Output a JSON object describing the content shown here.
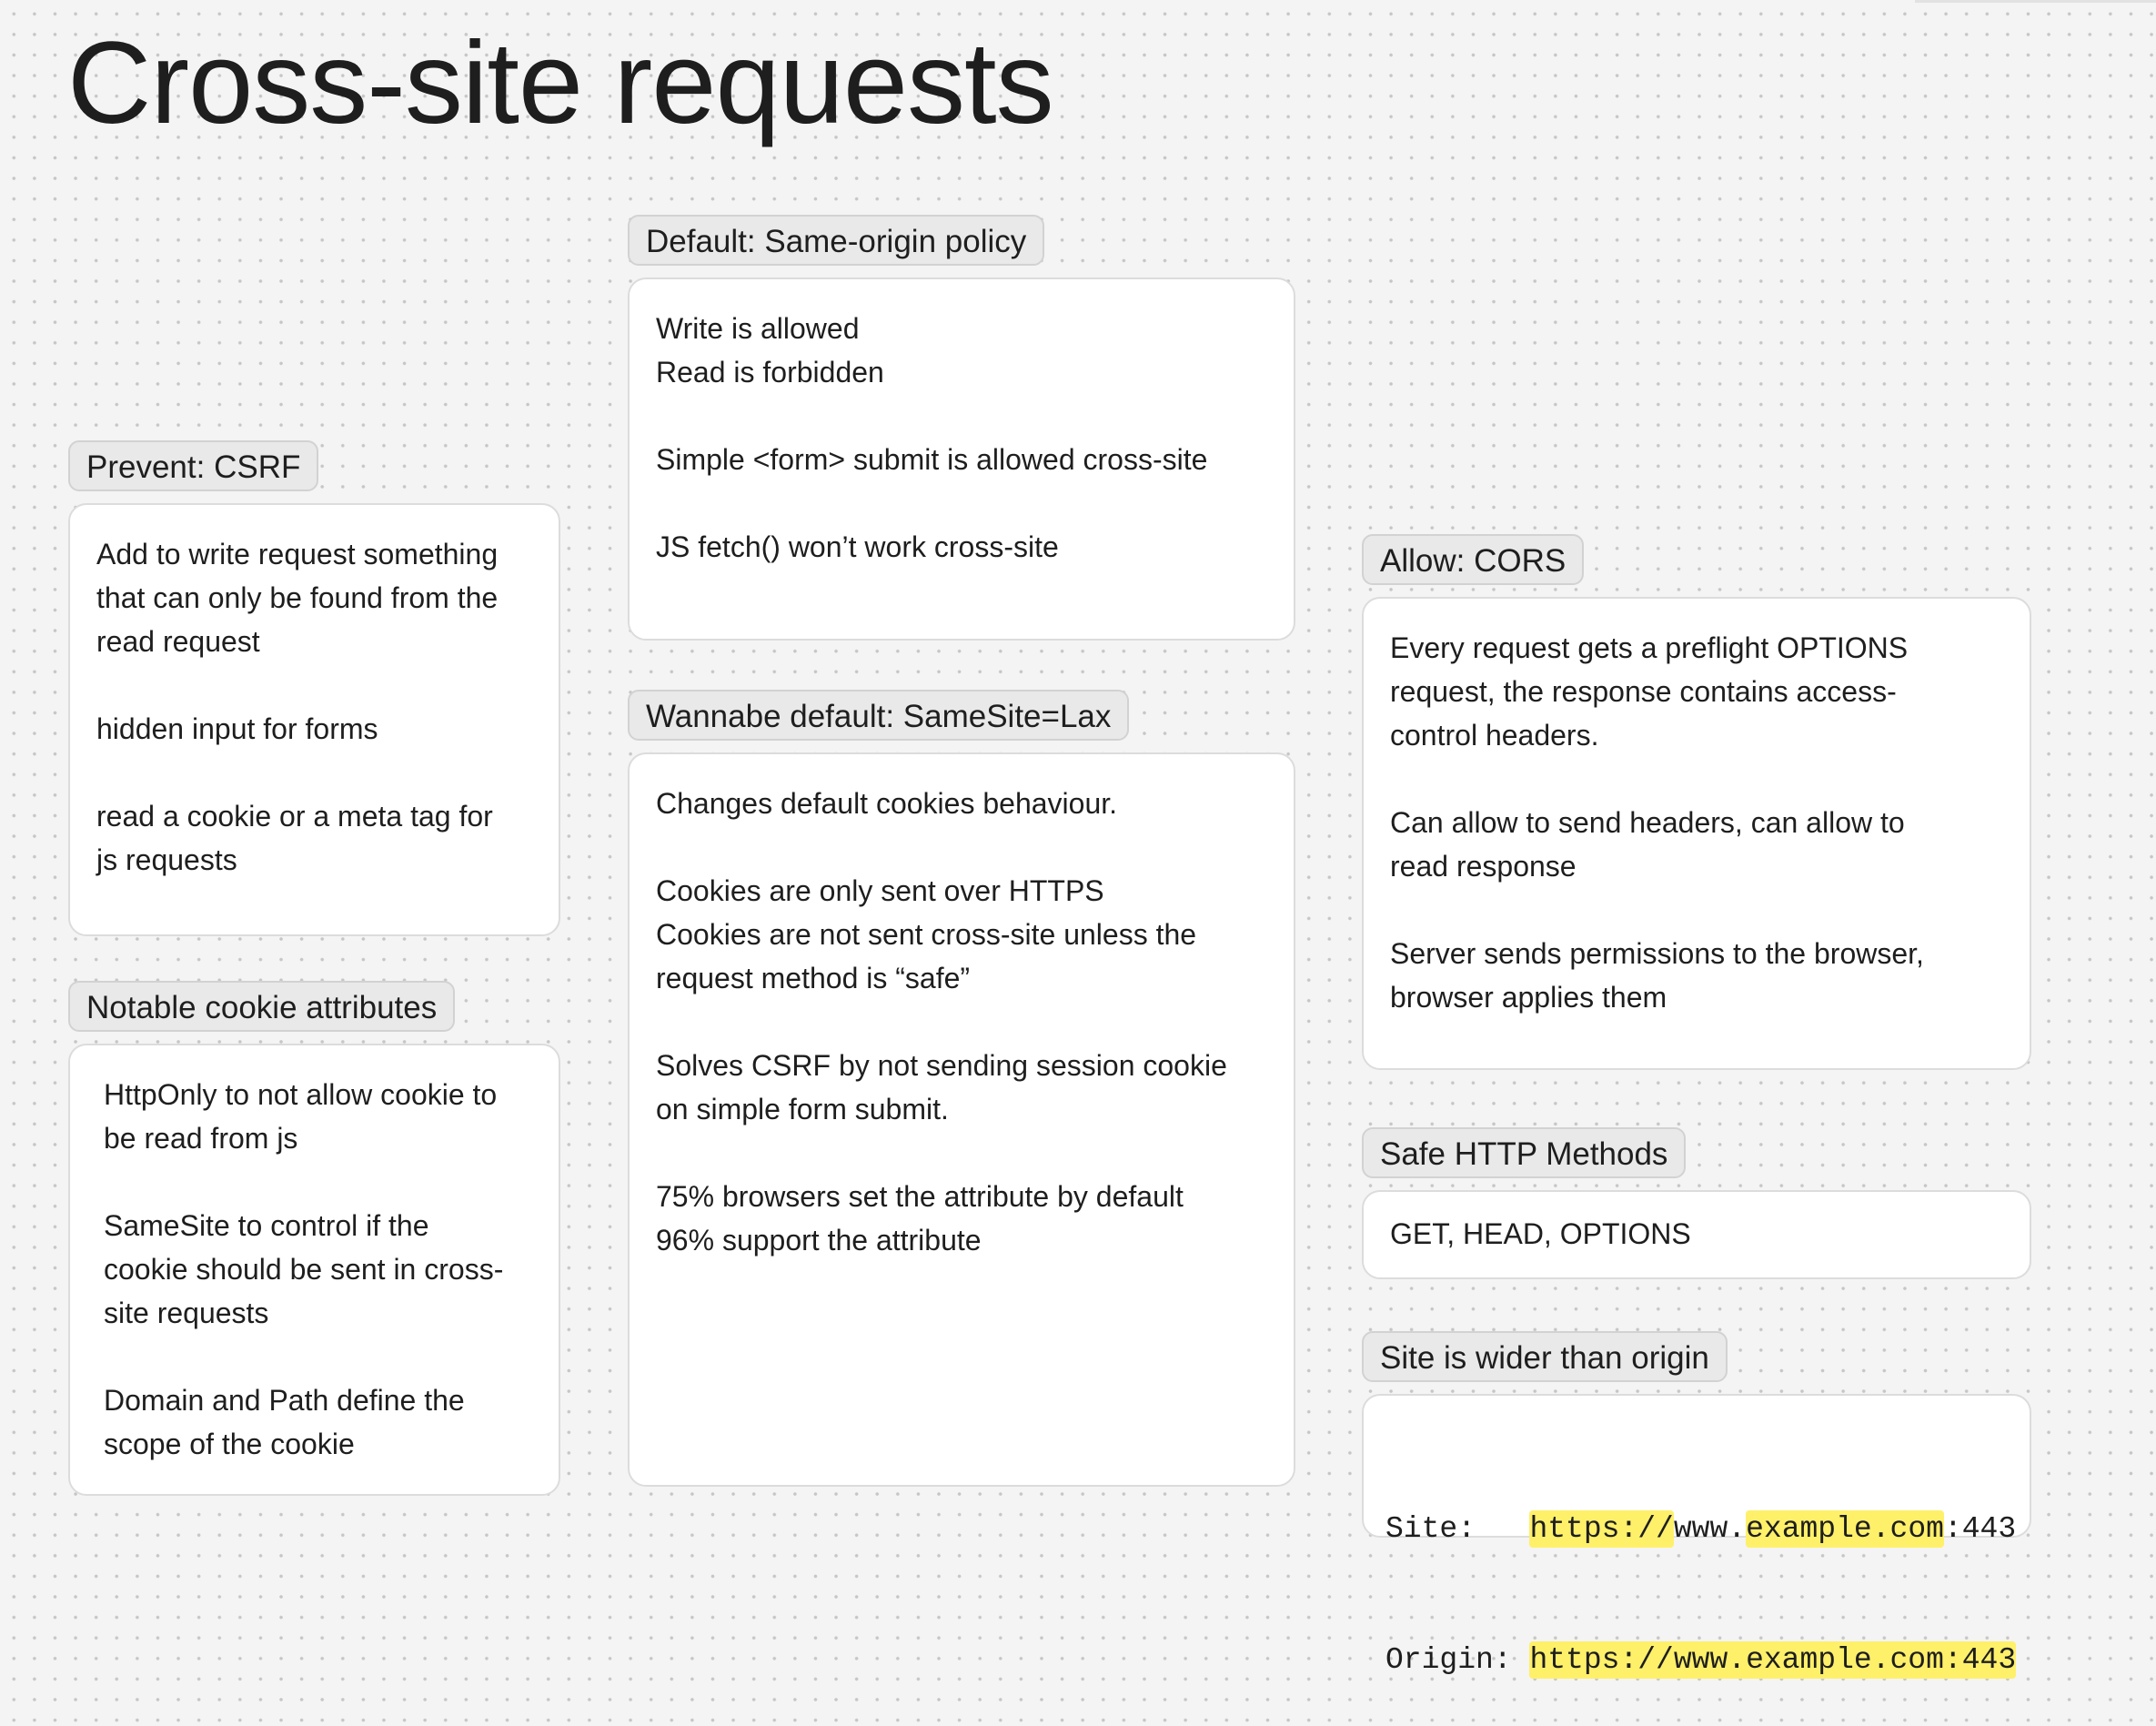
{
  "title": "Cross-site requests",
  "cards": {
    "same_origin": {
      "tag": "Default: Same-origin policy",
      "lines": [
        "Write is allowed",
        "Read is forbidden",
        "",
        "Simple <form> submit is allowed cross-site",
        "",
        "JS fetch() won’t work cross-site"
      ]
    },
    "csrf": {
      "tag": "Prevent: CSRF",
      "lines": [
        "Add to write request something",
        "that can only be found from the",
        "read request",
        "",
        "hidden input for forms",
        "",
        "read a cookie or a meta tag for",
        "js requests"
      ]
    },
    "cookie_attrs": {
      "tag": "Notable cookie attributes",
      "lines": [
        "HttpOnly to not allow cookie to",
        "be read from  js",
        "",
        "SameSite to control if the",
        "cookie should be sent in cross-",
        "site requests",
        "",
        "Domain and Path define the",
        "scope of the cookie"
      ]
    },
    "samesite": {
      "tag": "Wannabe default: SameSite=Lax",
      "lines": [
        "Changes default cookies behaviour.",
        "",
        "Cookies are only sent over HTTPS",
        "Cookies are not sent cross-site unless the",
        "request method is “safe”",
        "",
        "Solves CSRF by not sending session cookie",
        "on simple form submit.",
        "",
        "75% browsers set the attribute by default",
        "96% support the attribute"
      ]
    },
    "cors": {
      "tag": "Allow: CORS",
      "lines": [
        "Every request gets a preflight OPTIONS",
        "request, the response contains access-",
        "control headers.",
        "",
        "Can allow to send headers, can allow to",
        "read response",
        "",
        "Server sends permissions to the browser,",
        "browser applies them"
      ]
    },
    "safe_methods": {
      "tag": "Safe HTTP Methods",
      "lines": [
        "GET, HEAD, OPTIONS"
      ]
    },
    "site_origin": {
      "tag": "Site is wider than origin",
      "site": {
        "label": "Site:   ",
        "scheme": "https://",
        "sub": "www.",
        "domain": "example.com",
        "port": ":443"
      },
      "origin": {
        "label": "Origin: ",
        "full": "https://www.example.com:443"
      }
    }
  },
  "colors": {
    "highlight": "#fff06a",
    "card_bg": "#ffffff",
    "tag_bg": "#e9e9e9",
    "canvas_bg": "#f4f4f4"
  }
}
